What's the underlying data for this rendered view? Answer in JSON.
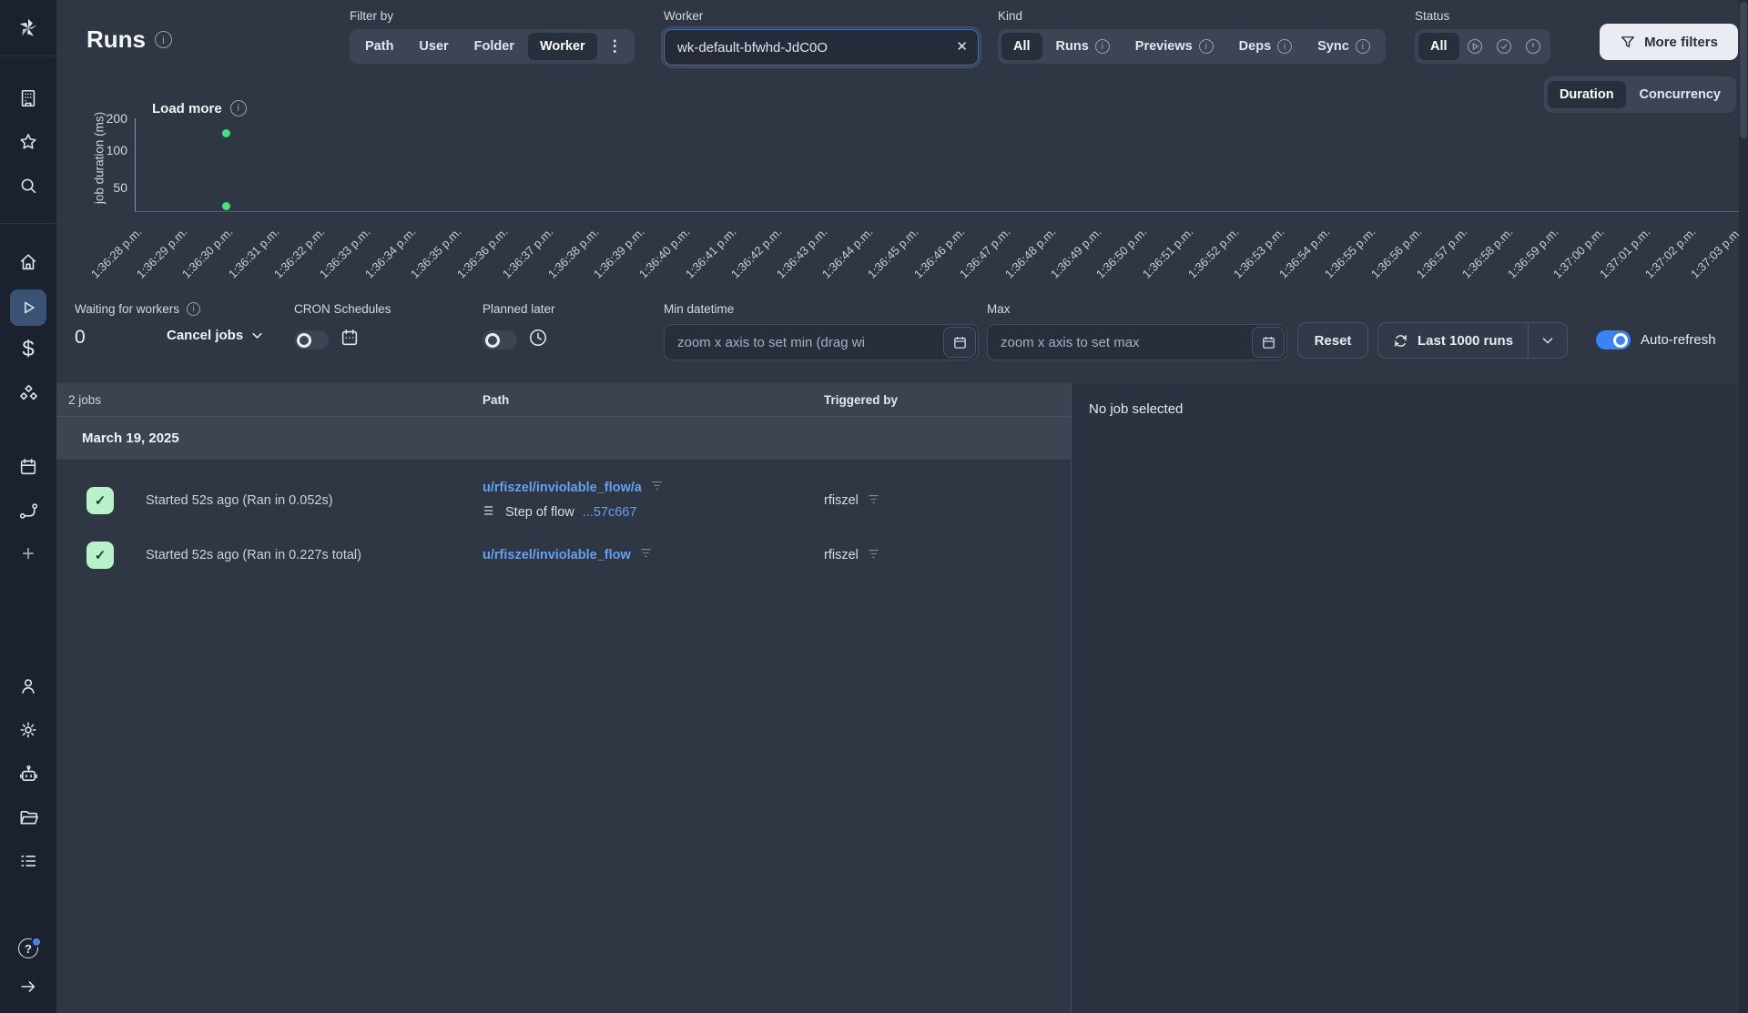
{
  "app": {
    "accent": "#3b82f6"
  },
  "icons": {
    "info": "i",
    "kebab": "⋮",
    "clear": "✕",
    "plus": "+",
    "dollar": "$",
    "help": "?",
    "check": "✓"
  },
  "sidebar": {
    "active_item": "runs",
    "items": [
      "workspace",
      "favorites",
      "search",
      "home",
      "runs",
      "variables",
      "resources",
      "schedules",
      "triggers",
      "add",
      "account",
      "settings",
      "workers",
      "folders",
      "groups",
      "help",
      "collapse"
    ]
  },
  "header": {
    "title": "Runs",
    "filter_by": {
      "label": "Filter by",
      "options": [
        "Path",
        "User",
        "Folder",
        "Worker"
      ],
      "selected": "Worker"
    },
    "worker": {
      "label": "Worker",
      "value": "wk-default-bfwhd-JdC0O"
    },
    "kind": {
      "label": "Kind",
      "selected": "All",
      "options": [
        {
          "label": "All",
          "info": false
        },
        {
          "label": "Runs",
          "info": true
        },
        {
          "label": "Previews",
          "info": true
        },
        {
          "label": "Deps",
          "info": true
        },
        {
          "label": "Sync",
          "info": true
        }
      ]
    },
    "status": {
      "label": "Status",
      "all_label": "All",
      "selected": "All",
      "icon_options": [
        "running",
        "success",
        "failure"
      ]
    },
    "more_filters": "More filters"
  },
  "chart_panel": {
    "view_toggle": {
      "options": [
        "Duration",
        "Concurrency"
      ],
      "selected": "Duration"
    },
    "load_more": "Load more"
  },
  "chart_data": {
    "type": "scatter",
    "title": "",
    "xlabel": "",
    "ylabel": "job duration (ms)",
    "y_scale": "log",
    "y_ticks": [
      200,
      100,
      50
    ],
    "grid": false,
    "legend": false,
    "x_labels": [
      "1:36:28 p.m.",
      "1:36:29 p.m.",
      "1:36:30 p.m.",
      "1:36:31 p.m.",
      "1:36:32 p.m.",
      "1:36:33 p.m.",
      "1:36:34 p.m.",
      "1:36:35 p.m.",
      "1:36:36 p.m.",
      "1:36:37 p.m.",
      "1:36:38 p.m.",
      "1:36:39 p.m.",
      "1:36:40 p.m.",
      "1:36:41 p.m.",
      "1:36:42 p.m.",
      "1:36:43 p.m.",
      "1:36:44 p.m.",
      "1:36:45 p.m.",
      "1:36:46 p.m.",
      "1:36:47 p.m.",
      "1:36:48 p.m.",
      "1:36:49 p.m.",
      "1:36:50 p.m.",
      "1:36:51 p.m.",
      "1:36:52 p.m.",
      "1:36:53 p.m.",
      "1:36:54 p.m.",
      "1:36:55 p.m.",
      "1:36:56 p.m.",
      "1:36:57 p.m.",
      "1:36:58 p.m.",
      "1:36:59 p.m.",
      "1:37:00 p.m.",
      "1:37:01 p.m.",
      "1:37:02 p.m.",
      "1:37:03 p.m."
    ],
    "points": [
      {
        "x": "1:36:30 p.m.",
        "y_ms": 227,
        "status": "success",
        "color": "#4ade80"
      },
      {
        "x": "1:36:30 p.m.",
        "y_ms": 52,
        "status": "success",
        "color": "#4ade80"
      }
    ]
  },
  "controls": {
    "waiting": {
      "label": "Waiting for workers",
      "count": "0"
    },
    "cancel_jobs": "Cancel jobs",
    "cron": {
      "label": "CRON Schedules",
      "enabled": false
    },
    "planned": {
      "label": "Planned later",
      "enabled": false
    },
    "min_datetime": {
      "label": "Min datetime",
      "placeholder": "zoom x axis to set min (drag wi"
    },
    "max_datetime": {
      "label": "Max",
      "placeholder": "zoom x axis to set max"
    },
    "reset": "Reset",
    "last_runs": "Last 1000 runs",
    "auto_refresh": {
      "label": "Auto-refresh",
      "enabled": true
    }
  },
  "table": {
    "count_label": "2 jobs",
    "col_path": "Path",
    "col_triggered": "Triggered by",
    "date_group": "March 19, 2025",
    "rows": [
      {
        "status": "success",
        "started": "Started 52s ago (Ran in 0.052s)",
        "path": "u/rfiszel/inviolable_flow/a",
        "step_prefix": "Step of flow ",
        "step_link": "...57c667",
        "triggered_by": "rfiszel"
      },
      {
        "status": "success",
        "started": "Started 52s ago (Ran in 0.227s total)",
        "path": "u/rfiszel/inviolable_flow",
        "step_prefix": "",
        "step_link": "",
        "triggered_by": "rfiszel"
      }
    ]
  },
  "detail_panel": {
    "empty": "No job selected"
  }
}
